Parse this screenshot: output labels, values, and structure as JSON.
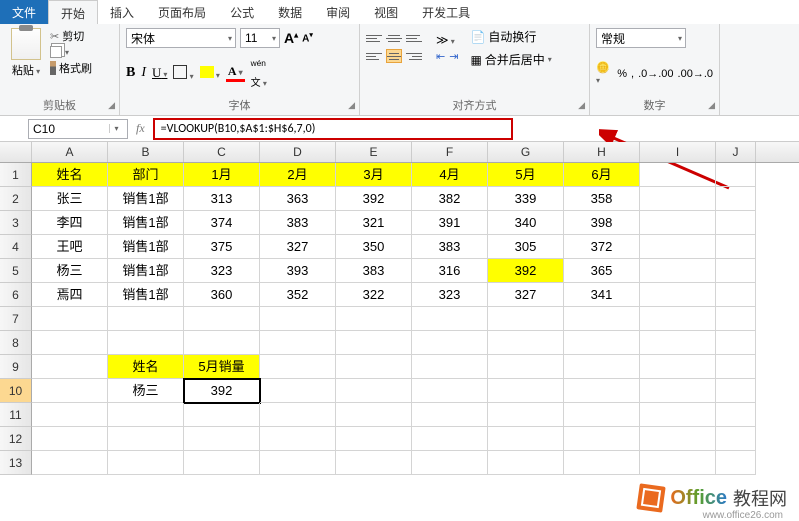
{
  "tabs": {
    "file": "文件",
    "home": "开始",
    "insert": "插入",
    "pagelayout": "页面布局",
    "formulas": "公式",
    "data": "数据",
    "review": "审阅",
    "view": "视图",
    "developer": "开发工具"
  },
  "ribbon": {
    "clipboard": {
      "label": "剪贴板",
      "paste": "粘贴",
      "cut": "剪切",
      "format_painter": "格式刷"
    },
    "font": {
      "label": "字体",
      "family": "宋体",
      "size": "11"
    },
    "alignment": {
      "label": "对齐方式",
      "wrap": "自动换行",
      "merge": "合并后居中"
    },
    "number": {
      "label": "数字",
      "format": "常规"
    }
  },
  "fbar": {
    "cellref": "C10",
    "fx": "fx",
    "formula": "=VLOOKUP(B10,$A$1:$H$6,7,0)"
  },
  "cols": [
    "A",
    "B",
    "C",
    "D",
    "E",
    "F",
    "G",
    "H",
    "I",
    "J"
  ],
  "rows": [
    "1",
    "2",
    "3",
    "4",
    "5",
    "6",
    "7",
    "8",
    "9",
    "10",
    "11",
    "12",
    "13"
  ],
  "table": {
    "headers": [
      "姓名",
      "部门",
      "1月",
      "2月",
      "3月",
      "4月",
      "5月",
      "6月"
    ],
    "data": [
      [
        "张三",
        "销售1部",
        "313",
        "363",
        "392",
        "382",
        "339",
        "358"
      ],
      [
        "李四",
        "销售1部",
        "374",
        "383",
        "321",
        "391",
        "340",
        "398"
      ],
      [
        "王吧",
        "销售1部",
        "375",
        "327",
        "350",
        "383",
        "305",
        "372"
      ],
      [
        "杨三",
        "销售1部",
        "323",
        "393",
        "383",
        "316",
        "392",
        "365"
      ],
      [
        "焉四",
        "销售1部",
        "360",
        "352",
        "322",
        "323",
        "327",
        "341"
      ]
    ]
  },
  "lookup": {
    "h1": "姓名",
    "h2": "5月销量",
    "name": "杨三",
    "value": "392"
  },
  "watermark": {
    "brand": "Office",
    "suffix": "教程网",
    "url": "www.office26.com"
  },
  "chart_data": {
    "type": "table",
    "title": "",
    "columns": [
      "姓名",
      "部门",
      "1月",
      "2月",
      "3月",
      "4月",
      "5月",
      "6月"
    ],
    "rows": [
      {
        "姓名": "张三",
        "部门": "销售1部",
        "1月": 313,
        "2月": 363,
        "3月": 392,
        "4月": 382,
        "5月": 339,
        "6月": 358
      },
      {
        "姓名": "李四",
        "部门": "销售1部",
        "1月": 374,
        "2月": 383,
        "3月": 321,
        "4月": 391,
        "5月": 340,
        "6月": 398
      },
      {
        "姓名": "王吧",
        "部门": "销售1部",
        "1月": 375,
        "2月": 327,
        "3月": 350,
        "4月": 383,
        "5月": 305,
        "6月": 372
      },
      {
        "姓名": "杨三",
        "部门": "销售1部",
        "1月": 323,
        "2月": 393,
        "3月": 383,
        "4月": 316,
        "5月": 392,
        "6月": 365
      },
      {
        "姓名": "焉四",
        "部门": "销售1部",
        "1月": 360,
        "2月": 352,
        "3月": 322,
        "4月": 323,
        "5月": 327,
        "6月": 341
      }
    ]
  }
}
